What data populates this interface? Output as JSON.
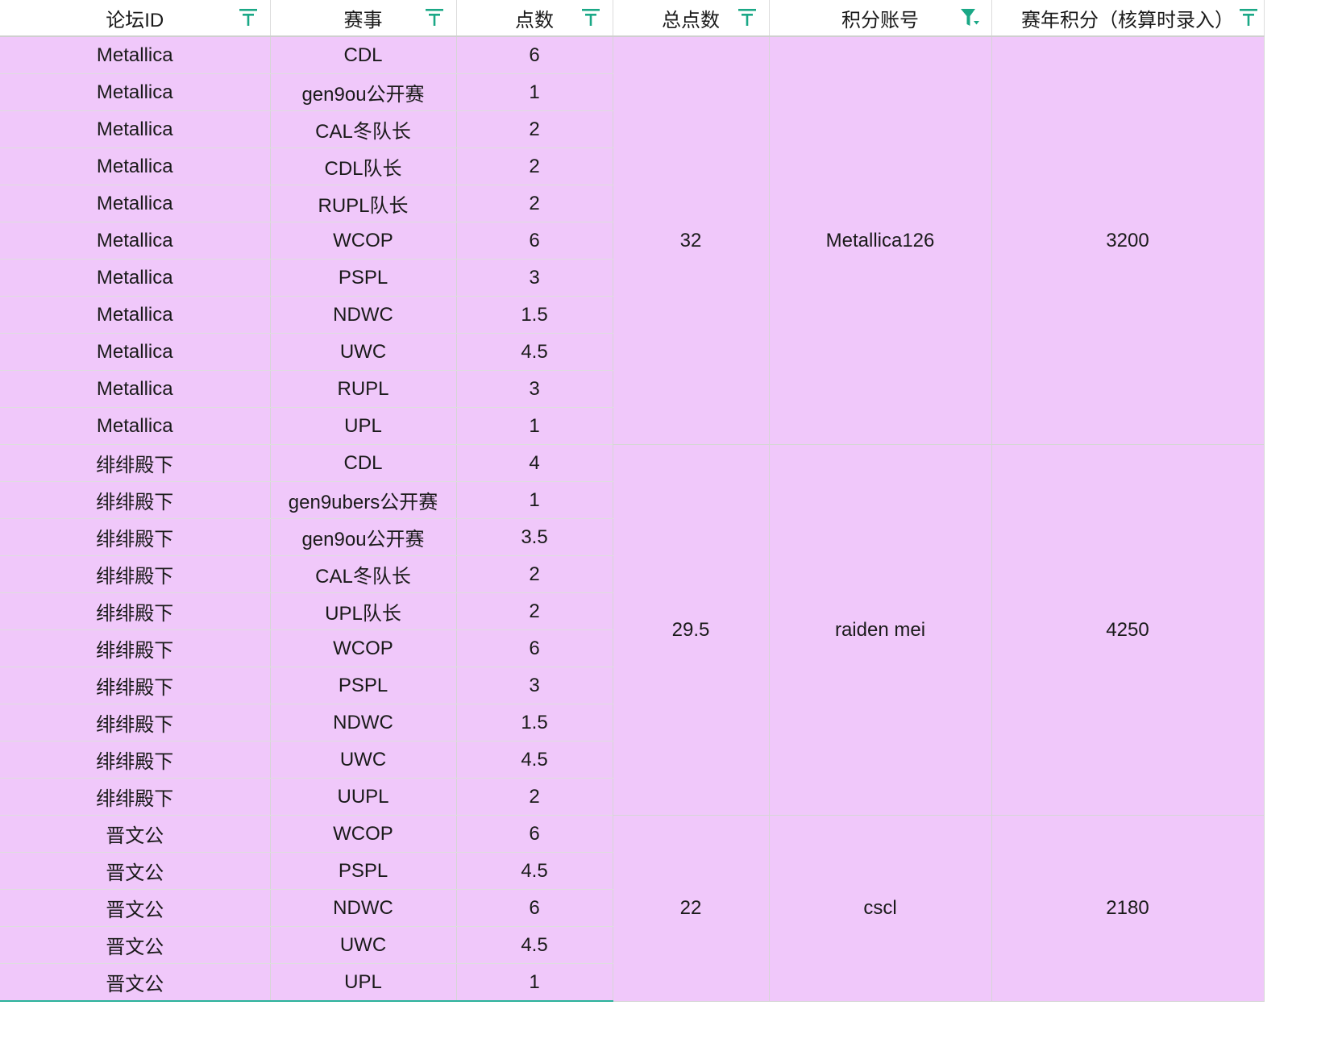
{
  "columns": [
    {
      "label": "论坛ID",
      "filter_active": false
    },
    {
      "label": "赛事",
      "filter_active": false
    },
    {
      "label": "点数",
      "filter_active": false
    },
    {
      "label": "总点数",
      "filter_active": false
    },
    {
      "label": "积分账号",
      "filter_active": true
    },
    {
      "label": "赛年积分（核算时录入）",
      "filter_active": false
    }
  ],
  "groups": [
    {
      "total": "32",
      "account": "Metallica126",
      "annual_points": "3200",
      "rows": [
        {
          "forum_id": "Metallica",
          "event": "CDL",
          "points": "6"
        },
        {
          "forum_id": "Metallica",
          "event": "gen9ou公开赛",
          "points": "1"
        },
        {
          "forum_id": "Metallica",
          "event": "CAL冬队长",
          "points": "2"
        },
        {
          "forum_id": "Metallica",
          "event": "CDL队长",
          "points": "2"
        },
        {
          "forum_id": "Metallica",
          "event": "RUPL队长",
          "points": "2"
        },
        {
          "forum_id": "Metallica",
          "event": "WCOP",
          "points": "6"
        },
        {
          "forum_id": "Metallica",
          "event": "PSPL",
          "points": "3"
        },
        {
          "forum_id": "Metallica",
          "event": "NDWC",
          "points": "1.5"
        },
        {
          "forum_id": "Metallica",
          "event": "UWC",
          "points": "4.5"
        },
        {
          "forum_id": "Metallica",
          "event": "RUPL",
          "points": "3"
        },
        {
          "forum_id": "Metallica",
          "event": "UPL",
          "points": "1"
        }
      ]
    },
    {
      "total": "29.5",
      "account": "raiden mei",
      "annual_points": "4250",
      "rows": [
        {
          "forum_id": "绯绯殿下",
          "event": "CDL",
          "points": "4"
        },
        {
          "forum_id": "绯绯殿下",
          "event": "gen9ubers公开赛",
          "points": "1"
        },
        {
          "forum_id": "绯绯殿下",
          "event": "gen9ou公开赛",
          "points": "3.5"
        },
        {
          "forum_id": "绯绯殿下",
          "event": "CAL冬队长",
          "points": "2"
        },
        {
          "forum_id": "绯绯殿下",
          "event": "UPL队长",
          "points": "2"
        },
        {
          "forum_id": "绯绯殿下",
          "event": "WCOP",
          "points": "6"
        },
        {
          "forum_id": "绯绯殿下",
          "event": "PSPL",
          "points": "3"
        },
        {
          "forum_id": "绯绯殿下",
          "event": "NDWC",
          "points": "1.5"
        },
        {
          "forum_id": "绯绯殿下",
          "event": "UWC",
          "points": "4.5"
        },
        {
          "forum_id": "绯绯殿下",
          "event": "UUPL",
          "points": "2"
        }
      ]
    },
    {
      "total": "22",
      "account": "cscl",
      "annual_points": "2180",
      "rows": [
        {
          "forum_id": "晋文公",
          "event": "WCOP",
          "points": "6"
        },
        {
          "forum_id": "晋文公",
          "event": "PSPL",
          "points": "4.5"
        },
        {
          "forum_id": "晋文公",
          "event": "NDWC",
          "points": "6"
        },
        {
          "forum_id": "晋文公",
          "event": "UWC",
          "points": "4.5"
        },
        {
          "forum_id": "晋文公",
          "event": "UPL",
          "points": "1"
        }
      ]
    }
  ],
  "colors": {
    "row_fill": "#f0c8fa",
    "filter_icon": "#1aa886",
    "selection_border": "#2bb39a"
  },
  "icons": {
    "filter_inactive": "filter-icon",
    "filter_active": "filter-active-icon"
  }
}
